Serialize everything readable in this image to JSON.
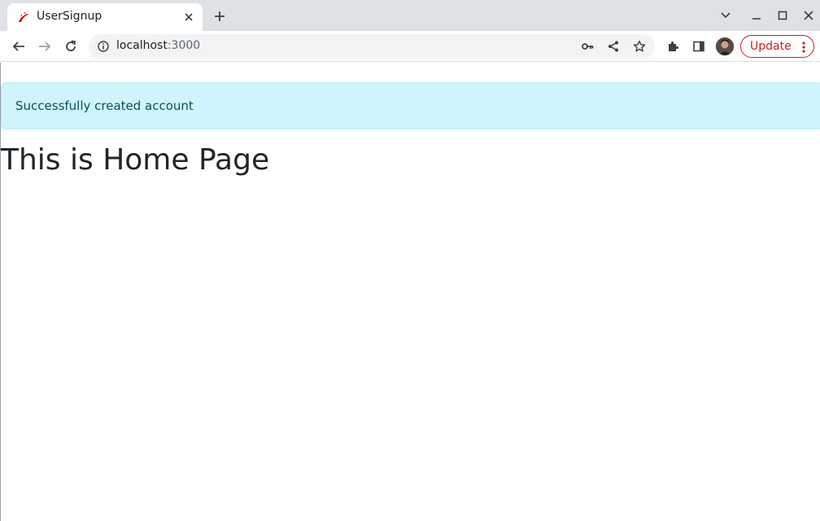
{
  "browser": {
    "tab": {
      "title": "UserSignup",
      "favicon": "rails-icon"
    },
    "address_bar": {
      "host": "localhost",
      "port": ":3000"
    },
    "update_button": {
      "label": "Update"
    }
  },
  "page": {
    "alert": {
      "message": "Successfully created account",
      "color": "#cff4fc"
    },
    "heading": "This is Home Page"
  },
  "colors": {
    "tabstrip": "#dee1e6",
    "alert_bg": "#cff4fc",
    "alert_text": "#055160",
    "update_accent": "#c5221f"
  }
}
